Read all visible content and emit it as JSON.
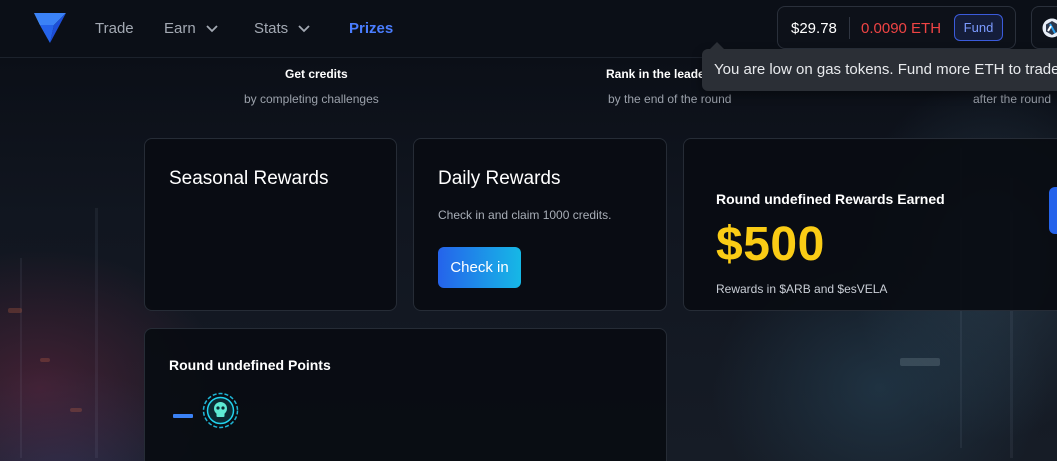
{
  "nav": {
    "items": [
      {
        "label": "Trade",
        "icon": null
      },
      {
        "label": "Earn",
        "icon": "chevron-down-icon"
      },
      {
        "label": "Stats",
        "icon": "chevron-down-icon"
      },
      {
        "label": "Prizes",
        "icon": null,
        "active": true
      }
    ]
  },
  "wallet": {
    "usd_balance": "$29.78",
    "eth_balance": "0.0090 ETH",
    "fund_label": "Fund"
  },
  "tooltip": {
    "text": "You are low on gas tokens. Fund more ETH to trade."
  },
  "steps": [
    {
      "title": "Get credits",
      "subtitle": "by completing challenges"
    },
    {
      "title": "Rank in the leade",
      "subtitle": "by the end of the round"
    },
    {
      "title": "",
      "subtitle": "after the round"
    }
  ],
  "seasonal": {
    "title": "Seasonal Rewards"
  },
  "daily": {
    "title": "Daily Rewards",
    "description": "Check in and claim 1000 credits.",
    "button_label": "Check in"
  },
  "rewards_earned": {
    "title": "Round undefined Rewards Earned",
    "amount": "$500",
    "note": "Rewards in $ARB and $esVELA"
  },
  "points": {
    "title": "Round undefined Points"
  },
  "colors": {
    "accent": "#4a7dff",
    "eth_negative": "#ef4444",
    "amount": "#facc15",
    "button_gradient_start": "#2563eb",
    "button_gradient_end": "#16b8e6"
  },
  "icons": {
    "logo": "vela-logo",
    "network": "arbitrum-icon",
    "points_badge": "skull-badge-icon"
  }
}
